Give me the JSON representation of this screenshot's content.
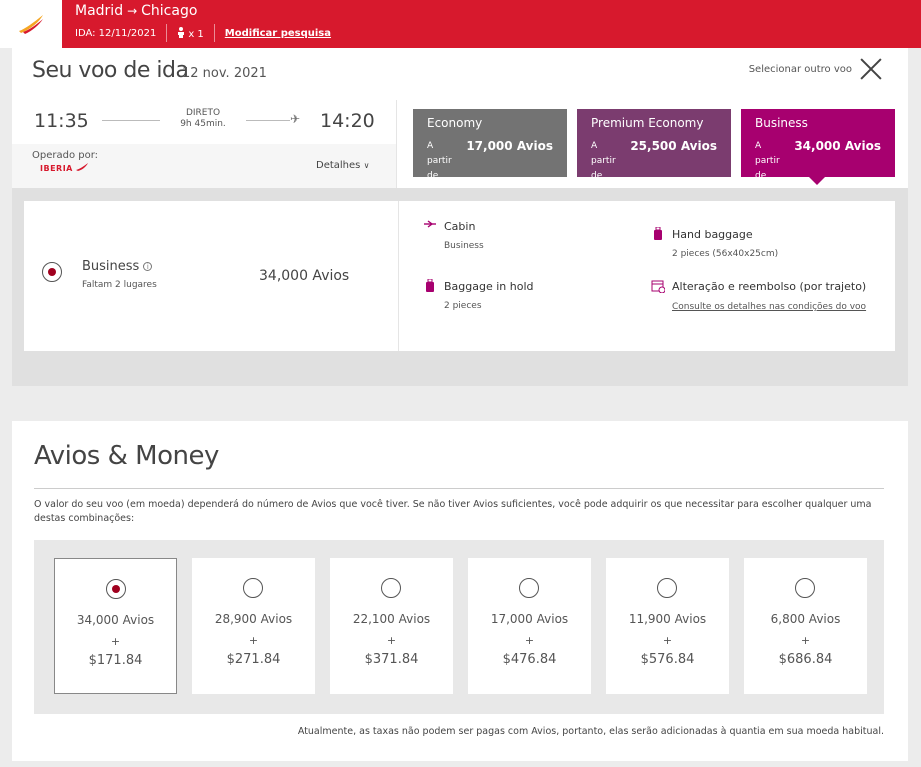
{
  "header": {
    "origin": "Madrid",
    "destination": "Chicago",
    "route_arrow": "→",
    "date_label": "IDA: 12/11/2021",
    "passengers": "x 1",
    "modify_link": "Modificar pesquisa"
  },
  "flight": {
    "title": "Seu voo de ida",
    "date": "12 nov. 2021",
    "select_other": "Selecionar outro voo",
    "departure_time": "11:35",
    "arrival_time": "14:20",
    "direct_label": "DIRETO",
    "duration": "9h 45min.",
    "operated_by_label": "Operado por:",
    "operator": "IBERIA",
    "details_label": "Detalhes"
  },
  "fares": [
    {
      "name": "Economy",
      "from_label": "A partir de",
      "price": "17,000 Avios",
      "color": "#737373"
    },
    {
      "name": "Premium Economy",
      "from_label": "A partir de",
      "price": "25,500 Avios",
      "color": "#7b3c6f"
    },
    {
      "name": "Business",
      "from_label": "A partir de",
      "price": "34,000 Avios",
      "color": "#a7006f"
    }
  ],
  "selected_fare": {
    "class_name": "Business",
    "seats_left": "Faltam 2 lugares",
    "avios": "34,000 Avios",
    "features": {
      "cabin_title": "Cabin",
      "cabin_value": "Business",
      "hand_title": "Hand baggage",
      "hand_value": "2 pieces (56x40x25cm)",
      "hold_title": "Baggage in hold",
      "hold_value": "2 pieces",
      "change_title": "Alteração e reembolso (por trajeto)",
      "change_link": "Consulte os detalhes nas condições do voo"
    }
  },
  "avios_money": {
    "title": "Avios & Money",
    "description": "O valor do seu voo (em moeda) dependerá do número de Avios que você tiver. Se não tiver Avios suficientes, você pode adquirir os que necessitar para escolher qualquer uma destas combinações:",
    "plus": "+",
    "options": [
      {
        "avios": "34,000 Avios",
        "money": "$171.84"
      },
      {
        "avios": "28,900 Avios",
        "money": "$271.84"
      },
      {
        "avios": "22,100 Avios",
        "money": "$371.84"
      },
      {
        "avios": "17,000 Avios",
        "money": "$476.84"
      },
      {
        "avios": "11,900 Avios",
        "money": "$576.84"
      },
      {
        "avios": "6,800 Avios",
        "money": "$686.84"
      }
    ],
    "note": "Atualmente, as taxas não podem ser pagas com Avios, portanto, elas serão adicionadas à quantia em sua moeda habitual."
  },
  "colors": {
    "brand_red": "#d7192d",
    "business_purple": "#a7006f",
    "radio_selected": "#a0001f"
  }
}
